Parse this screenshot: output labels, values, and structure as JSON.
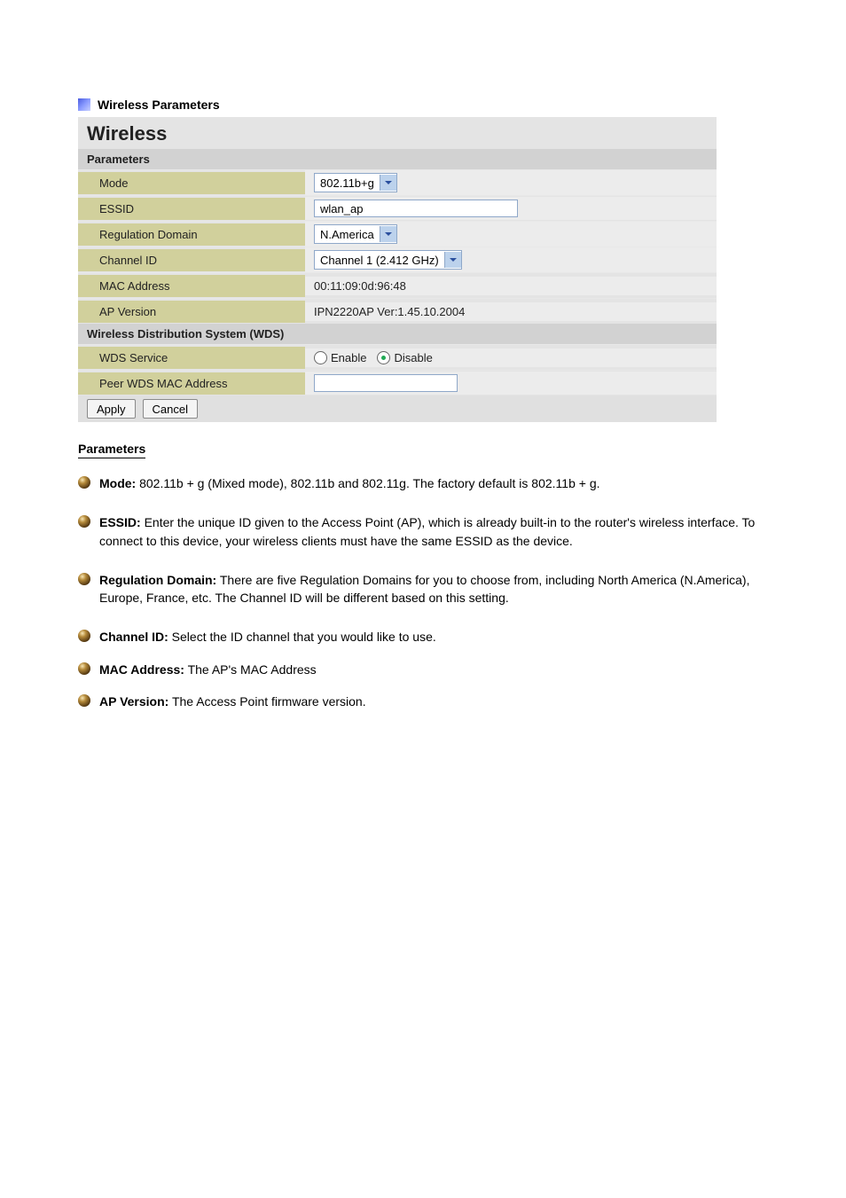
{
  "heading": "Wireless Parameters",
  "panel": {
    "title": "Wireless",
    "params_section": "Parameters",
    "rows": {
      "mode_label": "Mode",
      "mode_value": "802.11b+g",
      "essid_label": "ESSID",
      "essid_value": "wlan_ap",
      "reg_label": "Regulation Domain",
      "reg_value": "N.America",
      "chan_label": "Channel ID",
      "chan_value": "Channel 1 (2.412 GHz)",
      "mac_label": "MAC Address",
      "mac_value": "00:11:09:0d:96:48",
      "apver_label": "AP Version",
      "apver_value": "IPN2220AP Ver:1.45.10.2004"
    },
    "wds_section": "Wireless Distribution System (WDS)",
    "wds_service_label": "WDS Service",
    "wds_enable": "Enable",
    "wds_disable": "Disable",
    "wds_selected": "disable",
    "peer_label": "Peer WDS MAC Address",
    "peer_value": "",
    "apply": "Apply",
    "cancel": "Cancel"
  },
  "desc_heading": "Parameters",
  "bullets": [
    {
      "lead": "Mode:",
      "body": " 802.11b + g (Mixed mode), 802.11b and 802.11g. The factory default is 802.11b + g."
    },
    {
      "lead": "ESSID:",
      "body": " Enter the unique ID given to the Access Point (AP), which is already built-in to the router's wireless interface. To connect to this device, your wireless clients must have the same ESSID as the device."
    },
    {
      "lead": "Regulation Domain:",
      "body": " There are five Regulation Domains for you to choose from, including North America (N.America), Europe, France, etc. The Channel ID will be different based on this setting."
    },
    {
      "lead": "Channel ID:",
      "body": " Select the ID channel that you would like to use."
    },
    {
      "lead": "MAC Address:",
      "body": " The AP's MAC Address"
    },
    {
      "lead": "AP Version:",
      "body": " The Access Point firmware version."
    }
  ]
}
